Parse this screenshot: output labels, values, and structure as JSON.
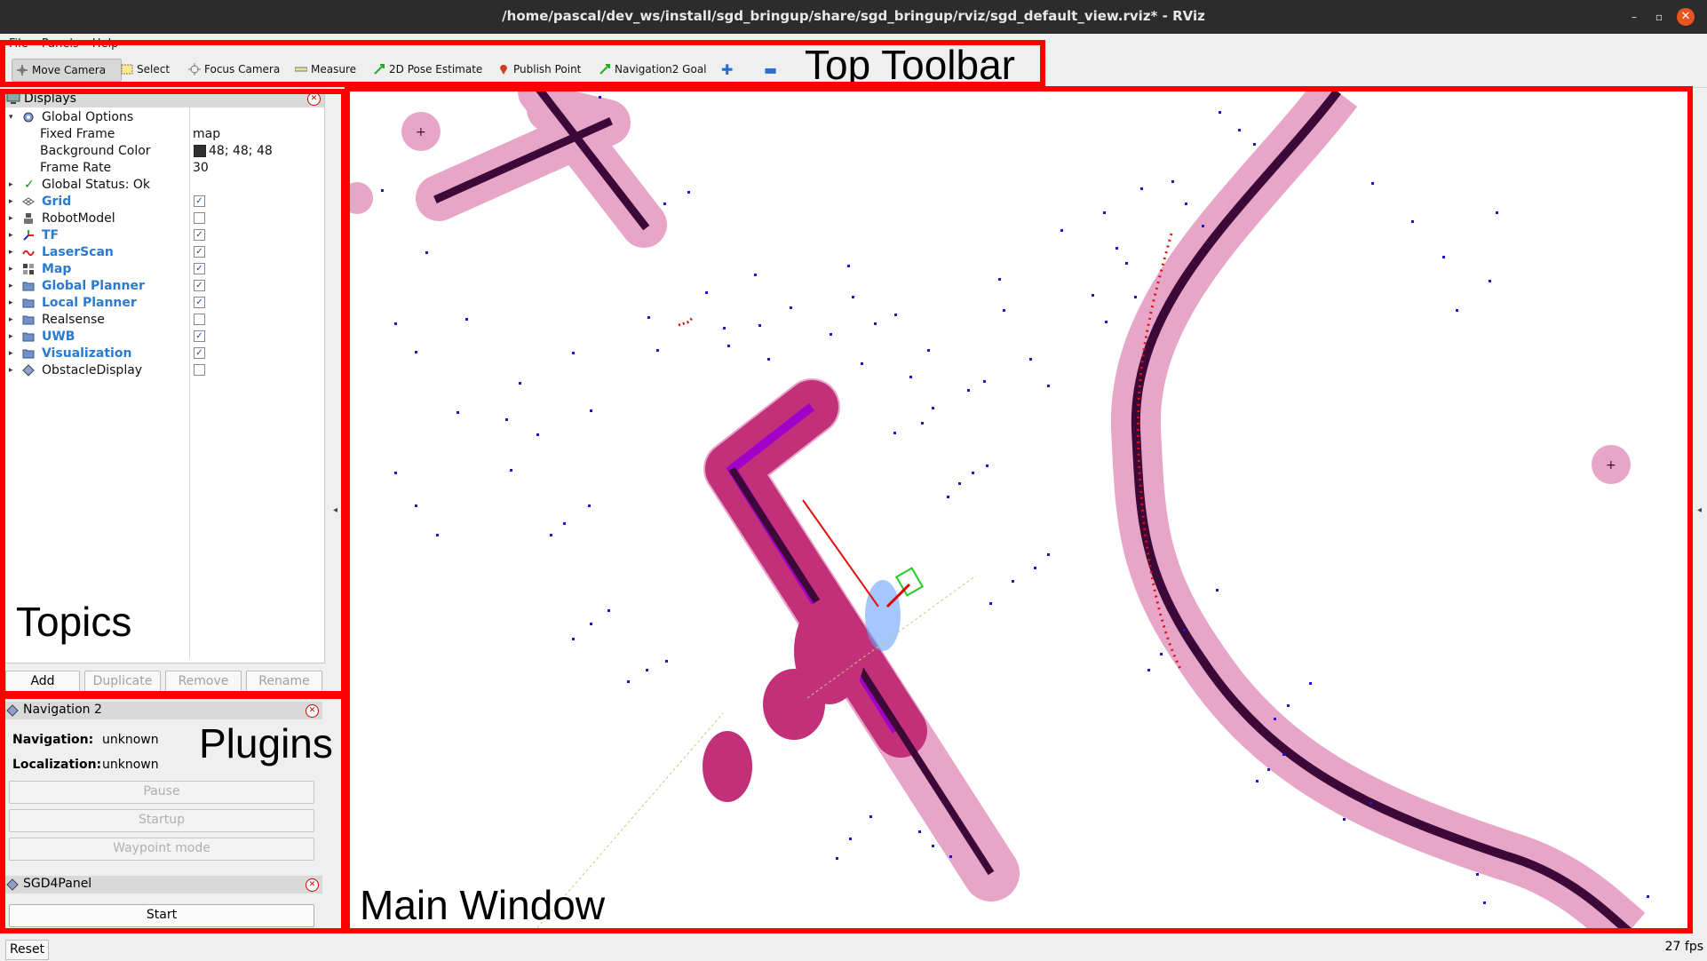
{
  "window": {
    "title": "/home/pascal/dev_ws/install/sgd_bringup/share/sgd_bringup/rviz/sgd_default_view.rviz* - RViz",
    "minimize": "–",
    "maximize": "▫",
    "close": "✕"
  },
  "menu": [
    "File",
    "Panels",
    "Help"
  ],
  "toolbar": {
    "tools": [
      {
        "label": "Move Camera",
        "icon": "move-camera-icon",
        "active": true
      },
      {
        "label": "Select",
        "icon": "select-icon"
      },
      {
        "label": "Focus Camera",
        "icon": "focus-camera-icon"
      },
      {
        "label": "Measure",
        "icon": "measure-icon"
      },
      {
        "label": "2D Pose Estimate",
        "icon": "pose-estimate-icon"
      },
      {
        "label": "Publish Point",
        "icon": "publish-point-icon"
      },
      {
        "label": "Navigation2 Goal",
        "icon": "nav-goal-icon"
      }
    ],
    "annotation": "Top Toolbar"
  },
  "displays": {
    "title": "Displays",
    "rows": [
      {
        "name": "Global Options",
        "icon": "gear-icon",
        "expanded": true
      },
      {
        "name": "Fixed Frame",
        "value": "map"
      },
      {
        "name": "Background Color",
        "value": "48; 48; 48",
        "swatch": "#303030"
      },
      {
        "name": "Frame Rate",
        "value": "30"
      },
      {
        "name": "Global Status: Ok",
        "icon": "check-icon"
      },
      {
        "name": "Grid",
        "icon": "grid-icon",
        "checked": true,
        "highlight": true
      },
      {
        "name": "RobotModel",
        "icon": "robot-model-icon",
        "checked": false
      },
      {
        "name": "TF",
        "icon": "tf-icon",
        "checked": true,
        "highlight": true
      },
      {
        "name": "LaserScan",
        "icon": "laser-scan-icon",
        "checked": true,
        "highlight": true
      },
      {
        "name": "Map",
        "icon": "map-icon",
        "checked": true,
        "highlight": true
      },
      {
        "name": "Global Planner",
        "icon": "folder-icon",
        "checked": true,
        "highlight": true
      },
      {
        "name": "Local Planner",
        "icon": "folder-icon",
        "checked": true,
        "highlight": true
      },
      {
        "name": "Realsense",
        "icon": "folder-icon",
        "checked": false
      },
      {
        "name": "UWB",
        "icon": "folder-icon",
        "checked": true,
        "highlight": true
      },
      {
        "name": "Visualization",
        "icon": "folder-icon",
        "checked": true,
        "highlight": true
      },
      {
        "name": "ObstacleDisplay",
        "icon": "obstacle-icon",
        "checked": false
      }
    ],
    "buttons": {
      "add": "Add",
      "duplicate": "Duplicate",
      "remove": "Remove",
      "rename": "Rename"
    },
    "annotation": "Topics"
  },
  "navigation_panel": {
    "title": "Navigation 2",
    "navigation_label": "Navigation:",
    "navigation_value": "unknown",
    "localization_label": "Localization:",
    "localization_value": "unknown",
    "pause": "Pause",
    "startup": "Startup",
    "waypoint": "Waypoint mode"
  },
  "sgd_panel": {
    "title": "SGD4Panel",
    "start": "Start"
  },
  "plugins_annotation": "Plugins",
  "main_annotation": "Main Window",
  "status": {
    "reset": "Reset",
    "fps": "27 fps"
  },
  "colors": {
    "annotation_box": "#ff0000",
    "wall": "#3c0838",
    "inflation": "#e7a6c8",
    "obstacle": "#c2307a",
    "particles": "#1a1acc",
    "highlight": "#2a7ad0"
  }
}
